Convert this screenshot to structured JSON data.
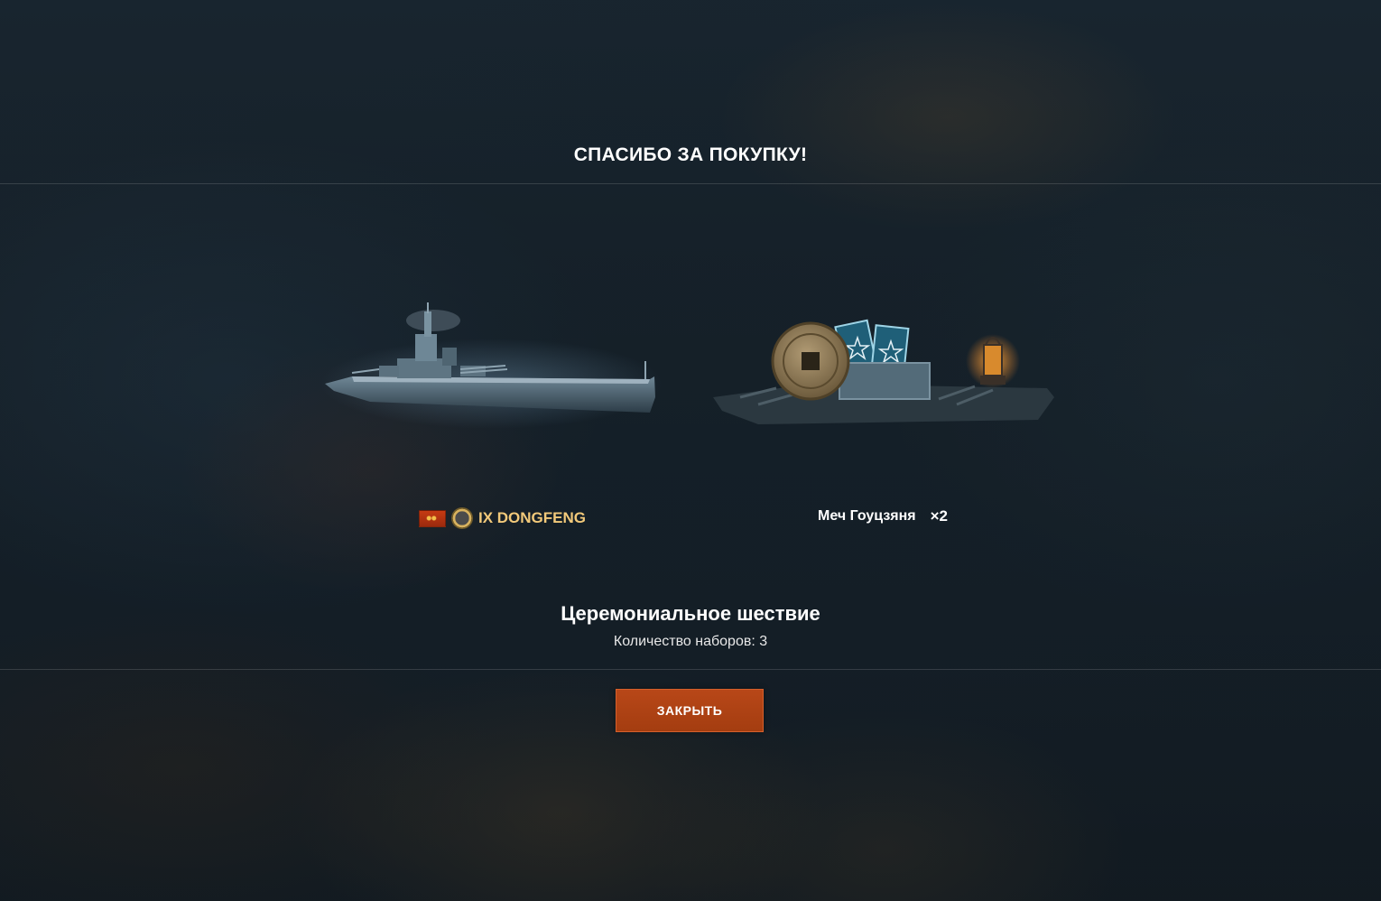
{
  "dialog": {
    "title": "СПАСИБО ЗА ПОКУПКУ!",
    "bundle_name": "Церемониальное шествие",
    "bundle_count": "Количество наборов: 3",
    "close_label": "ЗАКРЫТЬ"
  },
  "rewards": [
    {
      "type": "ship",
      "label": "IX DONGFENG",
      "icons": [
        "pan-asian-flag-icon",
        "destroyer-class-icon"
      ],
      "label_color": "#f2c97a"
    },
    {
      "type": "item",
      "label": "Меч Гоуцзяня",
      "multiplier": "×2",
      "icons": [
        "bronze-coin-icon",
        "flag-cards-icon",
        "lantern-icon"
      ]
    }
  ],
  "colors": {
    "accent_button": "#b84718",
    "premium_gold": "#f2c97a",
    "background": "#18242d"
  }
}
